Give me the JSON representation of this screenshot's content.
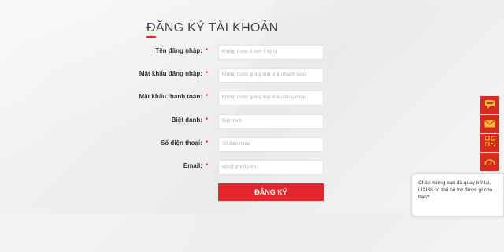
{
  "form": {
    "title": "ĐĂNG KÝ TÀI KHOẢN",
    "required_mark": "*",
    "fields": [
      {
        "label": "Tên đăng nhập:",
        "placeholder": "Không được ít hơn 5 ký tự"
      },
      {
        "label": "Mật khẩu đăng nhập:",
        "placeholder": "Không được giống mật khẩu thanh toán"
      },
      {
        "label": "Mật khẩu thanh toán:",
        "placeholder": "Không được giống mật khẩu đăng nhập"
      },
      {
        "label": "Biệt danh:",
        "placeholder": "Biệt danh"
      },
      {
        "label": "Số điện thoại:",
        "placeholder": "Số điện thoại"
      },
      {
        "label": "Email:",
        "placeholder": "abc@gmail.com"
      }
    ],
    "submit_label": "ĐĂNG KÝ"
  },
  "side_bar": {
    "items": [
      {
        "icon": "chat-bubble-icon"
      },
      {
        "icon": "mail-icon"
      },
      {
        "icon": "qr-code-icon"
      },
      {
        "icon": "speedometer-icon"
      }
    ],
    "accent_color": "#d82b1f"
  },
  "chat": {
    "message": "Chào mừng bạn đã quay trở lại, LIXI88 có thể hỗ trợ được gì cho bạn?"
  },
  "colors": {
    "accent": "#e3262e"
  }
}
